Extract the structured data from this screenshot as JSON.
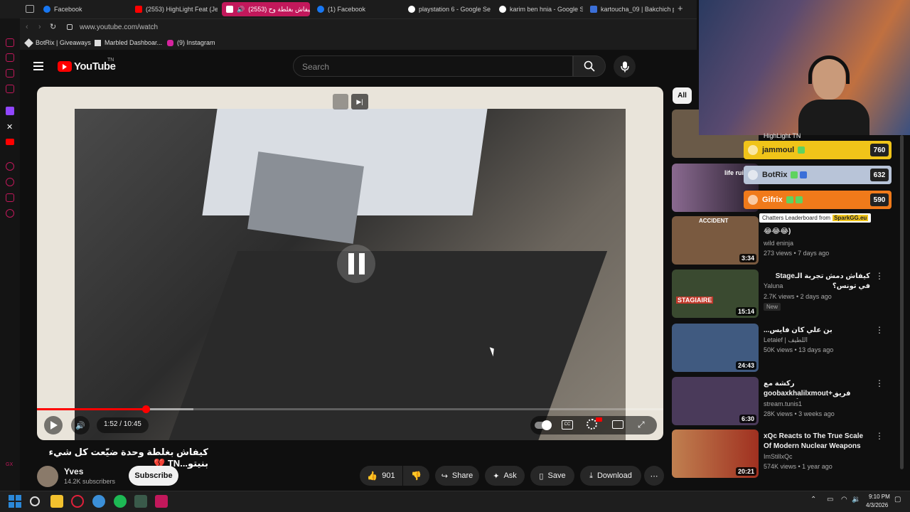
{
  "browser": {
    "tabs": [
      {
        "label": "Facebook",
        "active": false
      },
      {
        "label": "(2553) HighLight Feat (Je",
        "active": false
      },
      {
        "label": "كيفاش بغلطة وح (2553)",
        "active": true
      },
      {
        "label": "(1) Facebook",
        "active": false
      },
      {
        "label": "playstation 6 - Google Se",
        "active": false
      },
      {
        "label": "karim ben hnia - Google S",
        "active": false
      },
      {
        "label": "kartoucha_09 | Bakchich p",
        "active": false
      }
    ],
    "url": "www.youtube.com/watch",
    "bookmarks": [
      "BotRix | Giveaways",
      "Marbled Dashboar...",
      "(9) Instagram"
    ]
  },
  "youtube": {
    "logo": "YouTube",
    "region": "TN",
    "search_placeholder": "Search",
    "filter_chip": "All"
  },
  "player": {
    "time": "1:52 / 10:45",
    "progress": 0.174,
    "buffered": 0.25,
    "state": "paused"
  },
  "video": {
    "title": "كيفاش بغلطة وحدة ضيّعت كل شيء بنيتو...TN 💔",
    "channel": "Yves",
    "subscribers": "14.2K subscribers",
    "subscribe_label": "Subscribe",
    "likes": "901",
    "share_label": "Share",
    "ask_label": "Ask",
    "save_label": "Save",
    "download_label": "Download",
    "more_label": "⋯"
  },
  "recommendations": [
    {
      "title": "",
      "channel": "HighLight TN",
      "meta": "",
      "duration": "",
      "thumb": "#6a5a48"
    },
    {
      "title": "life rui",
      "channel": "",
      "meta": "",
      "duration": "",
      "thumb": "#8a6a90"
    },
    {
      "title": "😂😂😂)",
      "channel": "wild eninja",
      "meta": "273 views • 7 days ago",
      "duration": "3:34",
      "thumb": "#7a5a40",
      "badge": "ACCIDENT"
    },
    {
      "title": "كيفاش دمش تجربة الـStage في تونس؟",
      "channel": "Yaluna",
      "meta": "2.7K views • 2 days ago",
      "duration": "15:14",
      "thumb": "#3a4a30",
      "badge": "STAGIAIRE",
      "tag": "New"
    },
    {
      "title": "بن علي كان فايس...",
      "channel": "Letaief | اللطيف",
      "meta": "50K views • 13 days ago",
      "duration": "24:43",
      "thumb": "#405a80"
    },
    {
      "title": "ركشة مع goobaxkhalilxmout+فريق أكسيدوس...",
      "channel": "stream.tunis1",
      "meta": "28K views • 3 weeks ago",
      "duration": "6:30",
      "thumb": "#4a3a5a"
    },
    {
      "title": "xQc Reacts to The True Scale Of Modern Nuclear Weapons",
      "channel": "ImStillxQc",
      "meta": "574K views • 1 year ago",
      "duration": "20:21",
      "thumb": "#a06030"
    }
  ],
  "leaderboard": {
    "header": "HighLight TN",
    "rows": [
      {
        "name": "jammoul",
        "score": "760",
        "color": "#f0c419"
      },
      {
        "name": "BotRix",
        "score": "632",
        "color": "#b8c4d8"
      },
      {
        "name": "Gifrix",
        "score": "590",
        "color": "#f07a1a"
      }
    ],
    "footer": "Chatters Leaderboard from",
    "footer_brand": "SparkGG.eu"
  },
  "taskbar": {
    "time": "9:10 PM",
    "date": "4/3/2026"
  },
  "colors": {
    "accent": "#ff0000",
    "tab_active": "#c2185b"
  }
}
